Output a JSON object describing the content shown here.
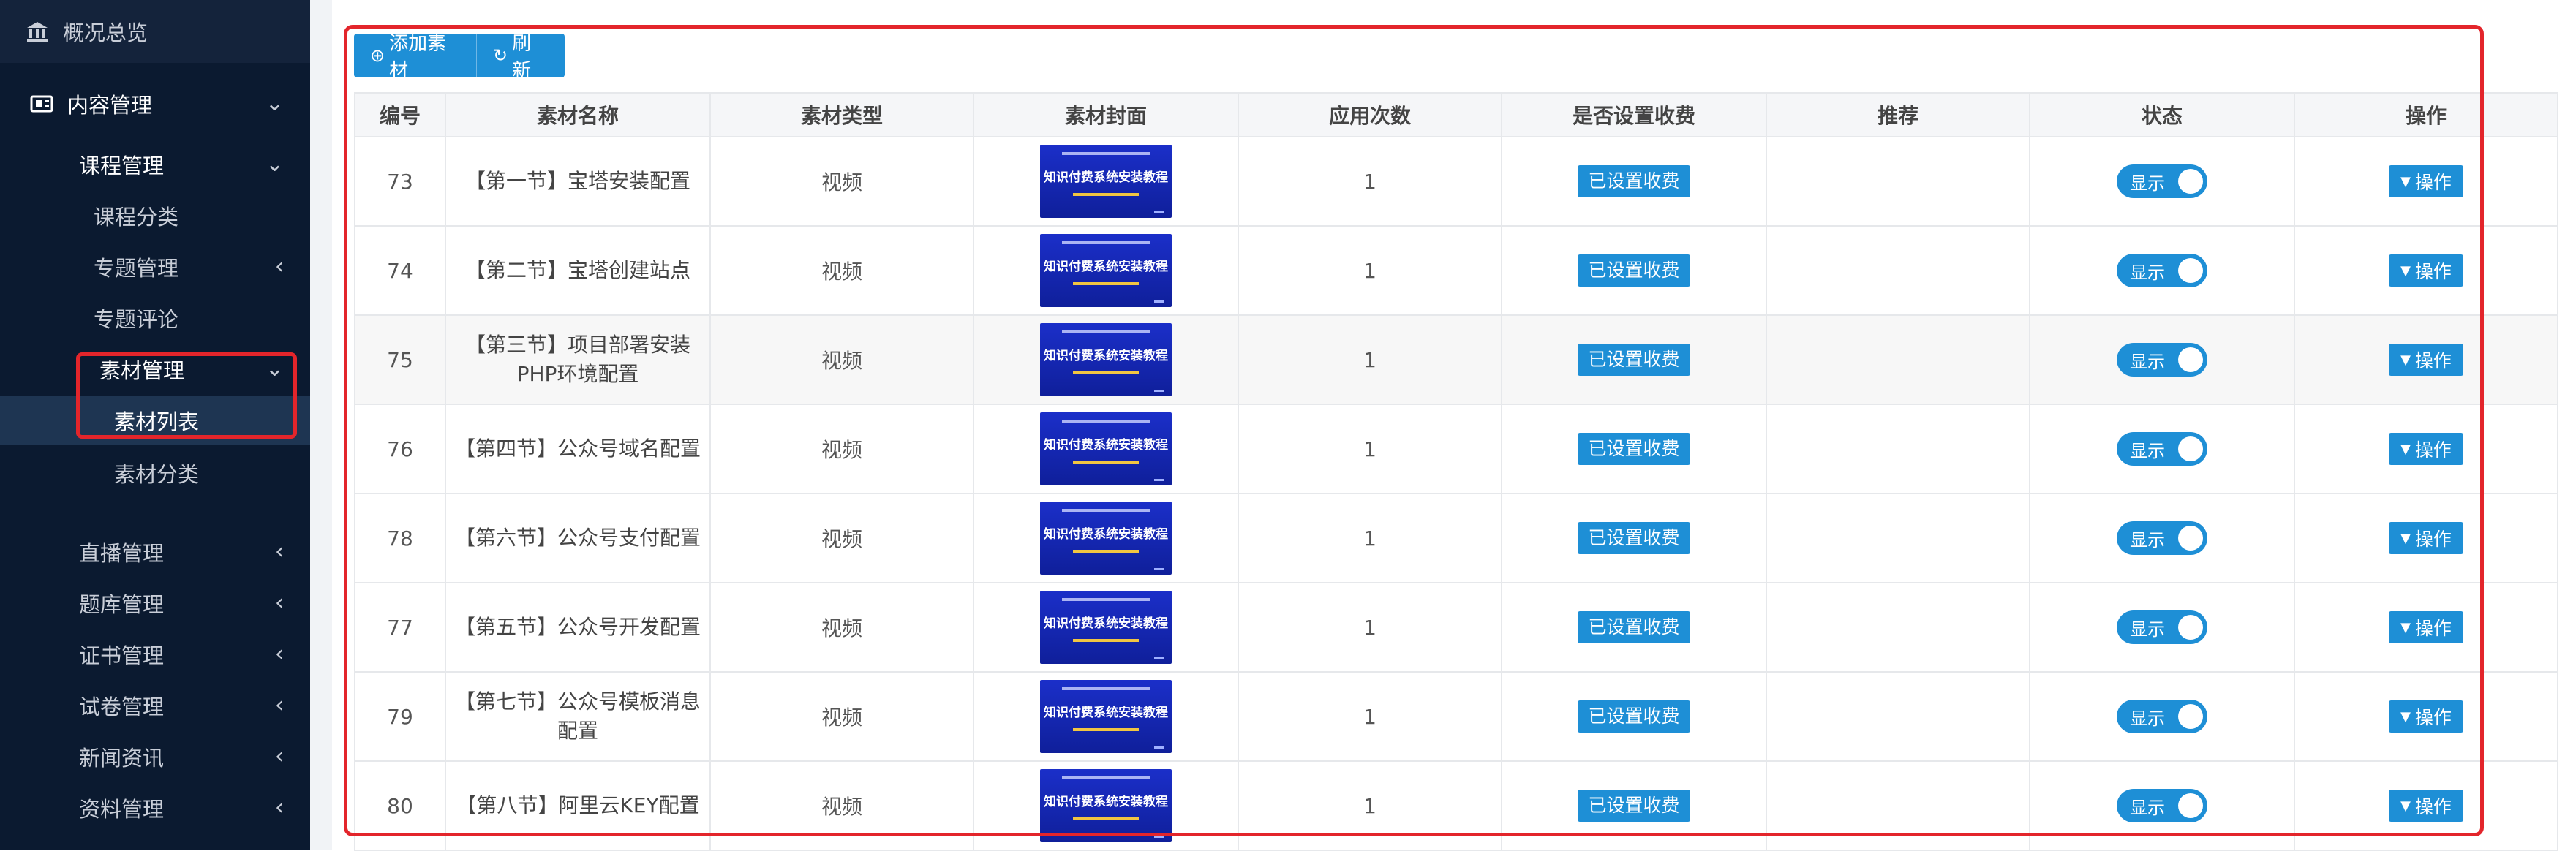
{
  "sidebar": {
    "items": [
      {
        "label": "概况总览",
        "icon": "bank-icon"
      },
      {
        "label": "内容管理",
        "icon": "content-icon"
      },
      {
        "label": "课程管理"
      },
      {
        "label": "课程分类"
      },
      {
        "label": "专题管理"
      },
      {
        "label": "专题评论"
      },
      {
        "label": "素材管理"
      },
      {
        "label": "素材列表"
      },
      {
        "label": "素材分类"
      },
      {
        "label": "直播管理"
      },
      {
        "label": "题库管理"
      },
      {
        "label": "证书管理"
      },
      {
        "label": "试卷管理"
      },
      {
        "label": "新闻资讯"
      },
      {
        "label": "资料管理"
      }
    ]
  },
  "toolbar": {
    "add_label": "添加素材",
    "refresh_label": "刷新"
  },
  "table": {
    "columns": [
      "编号",
      "素材名称",
      "素材类型",
      "素材封面",
      "应用次数",
      "是否设置收费",
      "推荐",
      "状态",
      "操作"
    ],
    "cover_title": "知识付费系统安装教程",
    "rows": [
      {
        "id": "73",
        "name": "【第一节】宝塔安装配置",
        "type": "视频",
        "uses": "1",
        "paid": "已设置收费",
        "status": "显示",
        "op": "操作"
      },
      {
        "id": "74",
        "name": "【第二节】宝塔创建站点",
        "type": "视频",
        "uses": "1",
        "paid": "已设置收费",
        "status": "显示",
        "op": "操作"
      },
      {
        "id": "75",
        "name": "【第三节】项目部署安装PHP环境配置",
        "type": "视频",
        "uses": "1",
        "paid": "已设置收费",
        "status": "显示",
        "op": "操作"
      },
      {
        "id": "76",
        "name": "【第四节】公众号域名配置",
        "type": "视频",
        "uses": "1",
        "paid": "已设置收费",
        "status": "显示",
        "op": "操作"
      },
      {
        "id": "78",
        "name": "【第六节】公众号支付配置",
        "type": "视频",
        "uses": "1",
        "paid": "已设置收费",
        "status": "显示",
        "op": "操作"
      },
      {
        "id": "77",
        "name": "【第五节】公众号开发配置",
        "type": "视频",
        "uses": "1",
        "paid": "已设置收费",
        "status": "显示",
        "op": "操作"
      },
      {
        "id": "79",
        "name": "【第七节】公众号模板消息配置",
        "type": "视频",
        "uses": "1",
        "paid": "已设置收费",
        "status": "显示",
        "op": "操作"
      },
      {
        "id": "80",
        "name": "【第八节】阿里云KEY配置",
        "type": "视频",
        "uses": "1",
        "paid": "已设置收费",
        "status": "显示",
        "op": "操作"
      }
    ]
  },
  "colors": {
    "sidebar_bg": "#0b1a30",
    "accent": "#1e8fd6",
    "highlight": "#e3252b"
  }
}
